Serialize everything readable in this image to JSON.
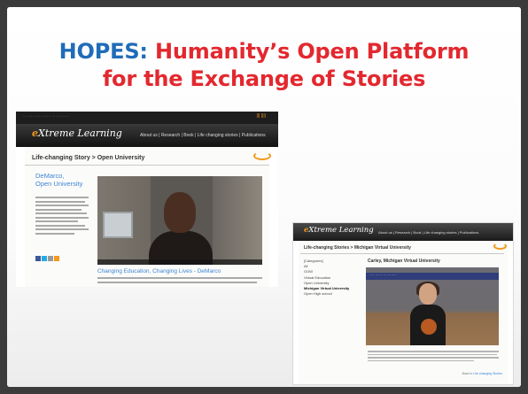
{
  "slide": {
    "title_part1": "HOPES:",
    "title_part2": " Humanity’s Open Platform",
    "title_line2": "for the Exchange of Stories",
    "title_colors": {
      "hopes": "#1f6cb8",
      "rest": "#e3282f"
    }
  },
  "shot1": {
    "top_links": "|||  ||||",
    "logo_e": "e",
    "logo_rest": "Xtreme Learning",
    "menu": "About us  |  Research  |  Book  |  Life changing stories  |  Publications",
    "breadcrumb": "Life-changing Story > Open University",
    "name_line1": "DeMarco,",
    "name_line2": "Open University",
    "caption": "Changing Education, Changing Lives - DeMarco",
    "icon_colors": [
      "#3b5998",
      "#29a9e1",
      "#9a9a9a",
      "#f39a1e"
    ]
  },
  "shot2": {
    "logo_e": "e",
    "logo_rest": "Xtreme Learning",
    "menu": "About us  |  Research  |  Book  |  Life changing stories  |  Publications",
    "breadcrumb": "Life-changing Stories > Michigan Virtual University",
    "categories": [
      "[Categories]",
      "All",
      "GOW",
      "Virtual Education",
      "Open University",
      "Michigan Virtual University",
      "Open High school"
    ],
    "active_category": "Michigan Virtual University",
    "student_name": "Carley, Michigan Virtual University",
    "back_prefix": "Back to",
    "back_link": "Life changing Stories"
  }
}
